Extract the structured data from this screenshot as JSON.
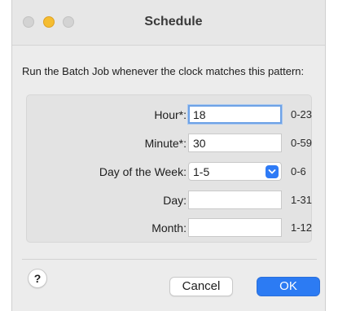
{
  "window": {
    "title": "Schedule"
  },
  "prompt": "Run the Batch Job whenever the clock matches this pattern:",
  "fields": [
    {
      "label": "Hour*:",
      "value": "18",
      "range": "0-23",
      "focused": true
    },
    {
      "label": "Minute*:",
      "value": "30",
      "range": "0-59"
    },
    {
      "label": "Day of the Week:",
      "value": "1-5",
      "range": "0-6",
      "type": "popup"
    },
    {
      "label": "Day:",
      "value": "",
      "range": "1-31"
    },
    {
      "label": "Month:",
      "value": "",
      "range": "1-12"
    }
  ],
  "buttons": {
    "help": "?",
    "cancel": "Cancel",
    "ok": "OK"
  },
  "colors": {
    "accent": "#2c7bf3",
    "minimize": "#f5bd31"
  }
}
